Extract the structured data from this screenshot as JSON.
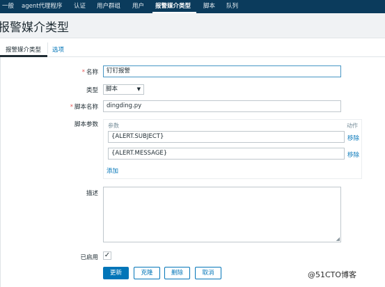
{
  "nav": {
    "items": [
      "一般",
      "agent代理程序",
      "认证",
      "用户群组",
      "用户",
      "报警媒介类型",
      "脚本",
      "队列"
    ],
    "active_index": 5
  },
  "page": {
    "title": "报警媒介类型"
  },
  "tabs": {
    "active": "报警媒介类型",
    "other": "选项"
  },
  "form": {
    "name_label": "名称",
    "name_value": "钉钉报警",
    "type_label": "类型",
    "type_value": "脚本",
    "script_name_label": "脚本名称",
    "script_name_value": "dingding.py",
    "script_params_label": "脚本参数",
    "params_header": "参数",
    "action_header": "动作",
    "params": [
      {
        "value": "{ALERT.SUBJECT}",
        "remove_label": "移除"
      },
      {
        "value": "{ALERT.MESSAGE}",
        "remove_label": "移除"
      }
    ],
    "add_label": "添加",
    "description_label": "描述",
    "description_value": "",
    "enabled_label": "已启用",
    "enabled": true
  },
  "buttons": {
    "update": "更新",
    "clone": "克隆",
    "delete": "删除",
    "cancel": "取消"
  },
  "watermark": "@51CTO博客",
  "colors": {
    "nav_bg": "#0b3b5c",
    "primary": "#0275b8",
    "required": "#e45959",
    "title_bg": "#f0f2f4"
  }
}
